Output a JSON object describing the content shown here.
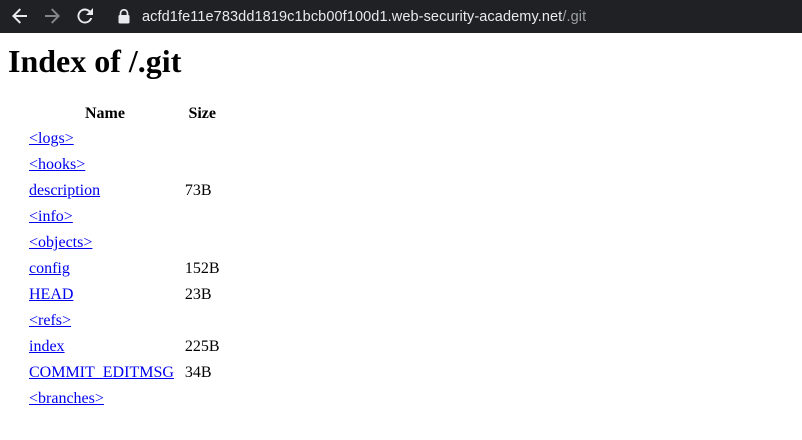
{
  "browser": {
    "url_host": "acfd1fe11e783dd1819c1bcb00f100d1.web-security-academy.net",
    "url_path": "/.git"
  },
  "page": {
    "title": "Index of /.git",
    "columns": {
      "name": "Name",
      "size": "Size"
    },
    "entries": [
      {
        "name": "<logs>",
        "size": ""
      },
      {
        "name": "<hooks>",
        "size": ""
      },
      {
        "name": "description",
        "size": "73B"
      },
      {
        "name": "<info>",
        "size": ""
      },
      {
        "name": "<objects>",
        "size": ""
      },
      {
        "name": "config",
        "size": "152B"
      },
      {
        "name": "HEAD",
        "size": "23B"
      },
      {
        "name": "<refs>",
        "size": ""
      },
      {
        "name": "index",
        "size": "225B"
      },
      {
        "name": "COMMIT_EDITMSG",
        "size": "34B"
      },
      {
        "name": "<branches>",
        "size": ""
      }
    ]
  },
  "icons": {
    "back": "arrow-left-icon",
    "forward": "arrow-right-icon",
    "reload": "reload-icon",
    "lock": "lock-icon"
  },
  "colors": {
    "toolbar_bg": "#202124",
    "url_text": "#e8eaed",
    "url_path": "#9aa0a6",
    "link": "#0000ee"
  }
}
